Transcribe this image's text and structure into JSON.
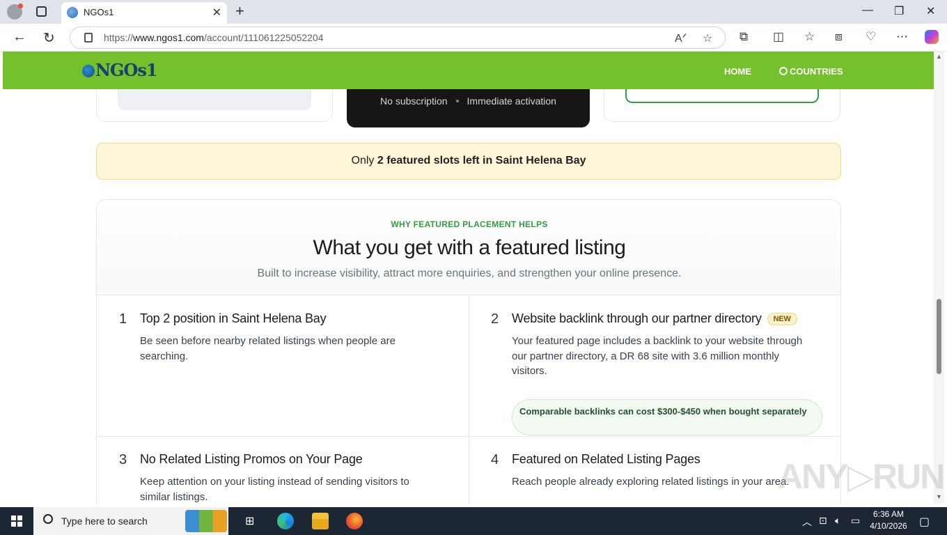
{
  "browser": {
    "tab_title": "NGOs1",
    "url_prefix": "https://",
    "url_host": "www.ngos1.com",
    "url_path": "/account/111061225052204"
  },
  "site": {
    "logo_text": "NGOs1",
    "nav_home": "HOME",
    "nav_countries": "COUNTRIES",
    "brand_color": "#74c12d"
  },
  "pricing": {
    "meta_left": "No subscription",
    "meta_right": "Immediate activation"
  },
  "banner": {
    "prefix": "Only",
    "highlight": "2 featured slots left in Saint Helena Bay"
  },
  "features_section": {
    "eyebrow": "WHY FEATURED PLACEMENT HELPS",
    "title": "What you get with a featured listing",
    "subtitle": "Built to increase visibility, attract more enquiries, and strengthen your online presence.",
    "items": [
      {
        "number": "1",
        "title": "Top 2 position in Saint Helena Bay",
        "description": "Be seen before nearby related listings when people are searching."
      },
      {
        "number": "2",
        "title": "Website backlink through our partner directory",
        "badge": "NEW",
        "description": "Your featured page includes a backlink to your website through our partner directory, a DR 68 site with 3.6 million monthly visitors.",
        "callout": "Comparable backlinks can cost $300-$450 when bought separately"
      },
      {
        "number": "3",
        "title": "No Related Listing Promos on Your Page",
        "description": "Keep attention on your listing instead of sending visitors to similar listings."
      },
      {
        "number": "4",
        "title": "Featured on Related Listing Pages",
        "description": "Reach people already exploring related listings in your area."
      }
    ]
  },
  "taskbar": {
    "search_placeholder": "Type here to search",
    "time": "6:36 AM",
    "date": "4/10/2026"
  }
}
